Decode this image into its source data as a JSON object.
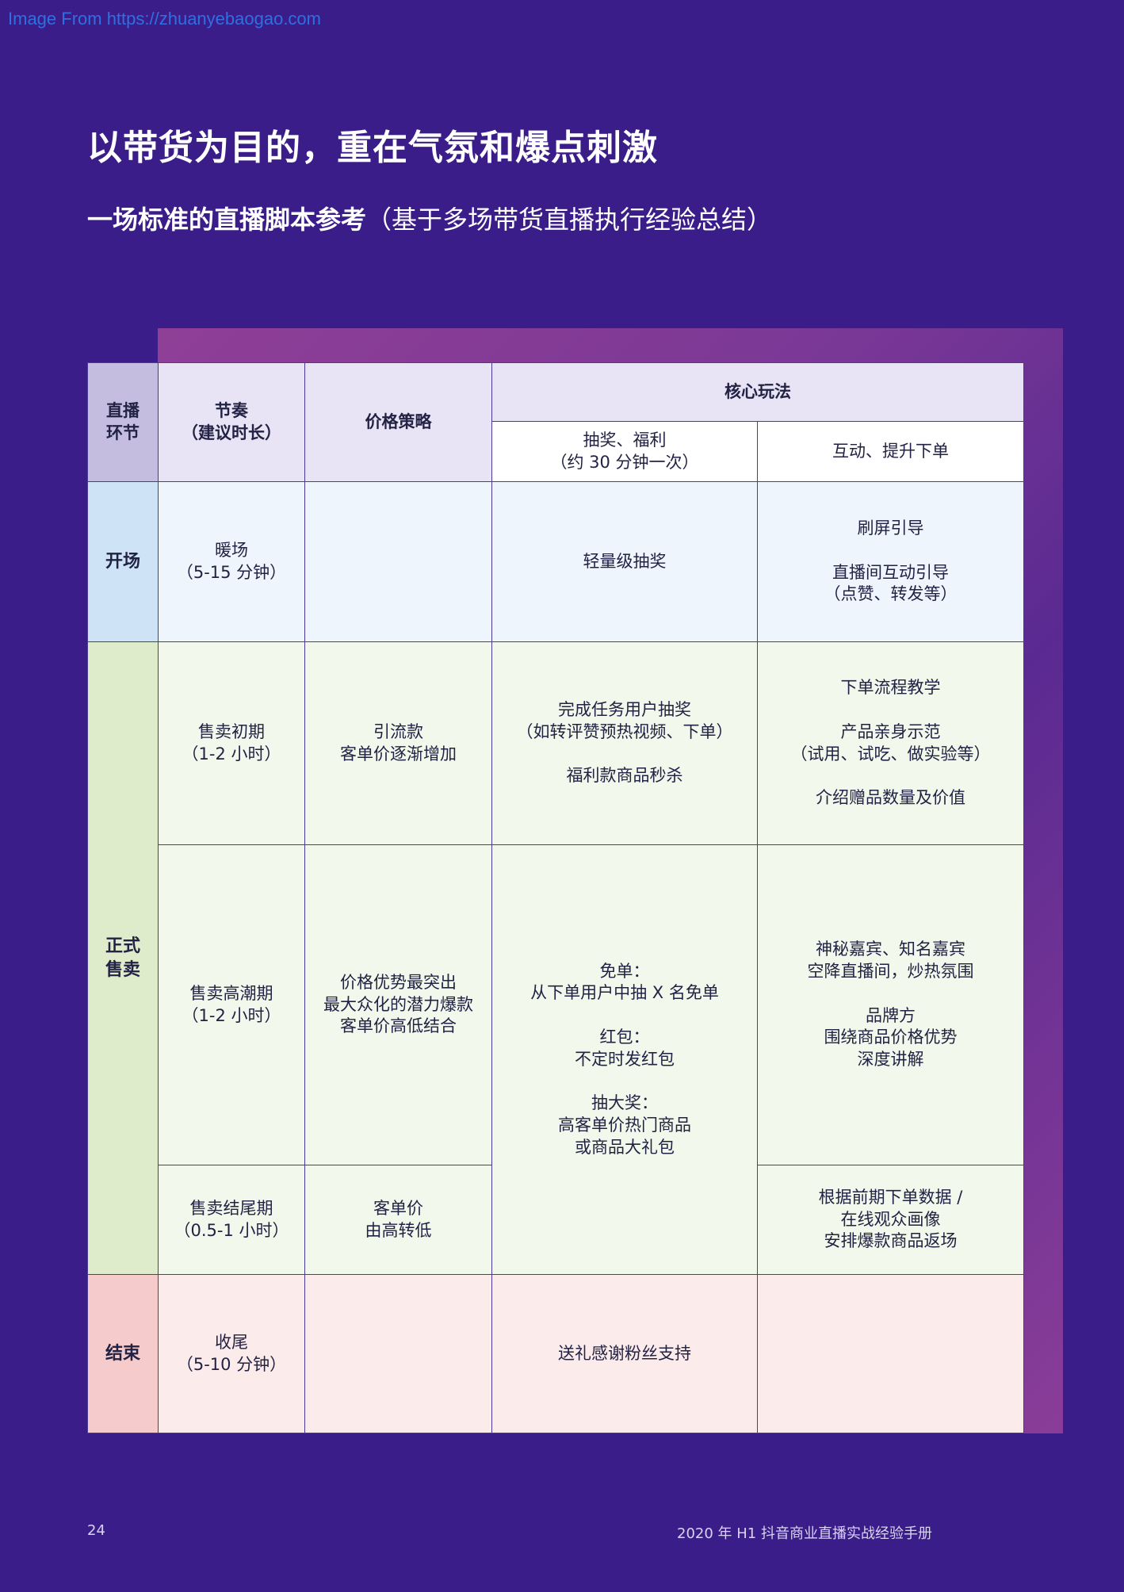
{
  "watermark": "Image From https://zhuanyebaogao.com",
  "title": "以带货为目的，重在气氛和爆点刺激",
  "subtitle": {
    "bold": "一场标准的直播脚本参考",
    "normal": "（基于多场带货直播执行经验总结）"
  },
  "table": {
    "header": {
      "stage": "直播\n环节",
      "rhythm": "节奏\n（建议时长）",
      "price": "价格策略",
      "core": "核心玩法",
      "lottery": "抽奖、福利\n（约 30 分钟一次）",
      "interact": "互动、提升下单"
    },
    "opening": {
      "stage": "开场",
      "rhythm": "暖场\n（5-15 分钟）",
      "price": "",
      "lottery": "轻量级抽奖",
      "interact": "刷屏引导\n\n直播间互动引导\n（点赞、转发等）"
    },
    "selling": {
      "stage": "正式\n售卖",
      "early": {
        "rhythm": "售卖初期\n（1-2 小时）",
        "price": "引流款\n客单价逐渐增加",
        "lottery": "完成任务用户抽奖\n（如转评赞预热视频、下单）\n\n福利款商品秒杀",
        "interact": "下单流程教学\n\n产品亲身示范\n（试用、试吃、做实验等）\n\n介绍赠品数量及价值"
      },
      "peak": {
        "rhythm": "售卖高潮期\n（1-2 小时）",
        "price": "价格优势最突出\n最大众化的潜力爆款\n客单价高低结合",
        "lottery": "免单：\n从下单用户中抽 X 名免单\n\n红包：\n不定时发红包\n\n抽大奖：\n高客单价热门商品\n或商品大礼包",
        "interact": "神秘嘉宾、知名嘉宾\n空降直播间，炒热氛围\n\n品牌方\n围绕商品价格优势\n深度讲解"
      },
      "ending": {
        "rhythm": "售卖结尾期\n（0.5-1 小时）",
        "price": "客单价\n由高转低",
        "interact": "根据前期下单数据 /\n在线观众画像\n安排爆款商品返场"
      }
    },
    "closing": {
      "stage": "结束",
      "rhythm": "收尾\n（5-10 分钟）",
      "price": "",
      "lottery": "送礼感谢粉丝支持",
      "interact": ""
    }
  },
  "footer": {
    "page_number": "24",
    "doc_title": "2020 年 H1 抖音商业直播实战经验手册"
  }
}
